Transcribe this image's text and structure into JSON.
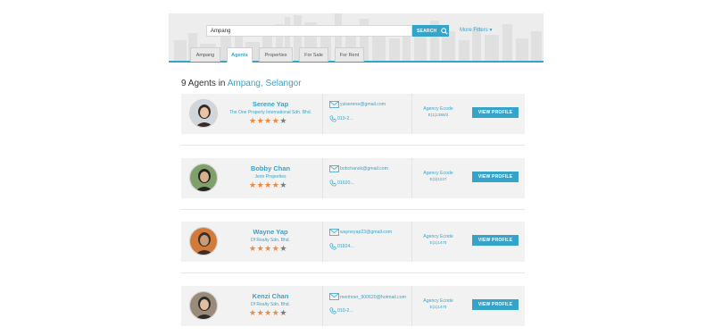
{
  "search": {
    "query": "Ampang",
    "button_label": "SEARCH",
    "more_filters": "More Filters"
  },
  "tabs": [
    {
      "label": "Ampang"
    },
    {
      "label": "Agents"
    },
    {
      "label": "Properties"
    },
    {
      "label": "For Sale"
    },
    {
      "label": "For Rent"
    }
  ],
  "heading": {
    "prefix": "9 Agents in",
    "location": "Ampang, Selangor"
  },
  "agents": [
    {
      "name": "Serene Yap",
      "company": "The One Property International Sdn. Bhd.",
      "rating": 4,
      "email": "ysiserene@gmail.com",
      "phone": "019-2...",
      "agency_label": "Agency Ecode",
      "agency_code": "E(1)1398/2",
      "button": "VIEW PROFILE"
    },
    {
      "name": "Bobby Chan",
      "company": "Jenn Properties",
      "rating": 4,
      "email": "bobchansk@gmail.com",
      "phone": "01620...",
      "agency_label": "Agency Ecode",
      "agency_code": "E(3)1227",
      "button": "VIEW PROFILE"
    },
    {
      "name": "Wayne Yap",
      "company": "Df Realty Sdn. Bhd.",
      "rating": 4,
      "email": "wayneyap23@gmail.com",
      "phone": "01824...",
      "agency_label": "Agency Ecode",
      "agency_code": "E(1)1476",
      "button": "VIEW PROFILE"
    },
    {
      "name": "Kenzi Chan",
      "company": "Df Realty Sdn. Bhd.",
      "rating": 4,
      "email": "menhoer_900620@hotmail.com",
      "phone": "010-2...",
      "agency_label": "Agency Ecode",
      "agency_code": "E(1)1476",
      "button": "VIEW PROFILE"
    }
  ],
  "colors": {
    "accent": "#36a4c9",
    "star": "#f0883c",
    "card_bg": "#f2f2f2"
  }
}
